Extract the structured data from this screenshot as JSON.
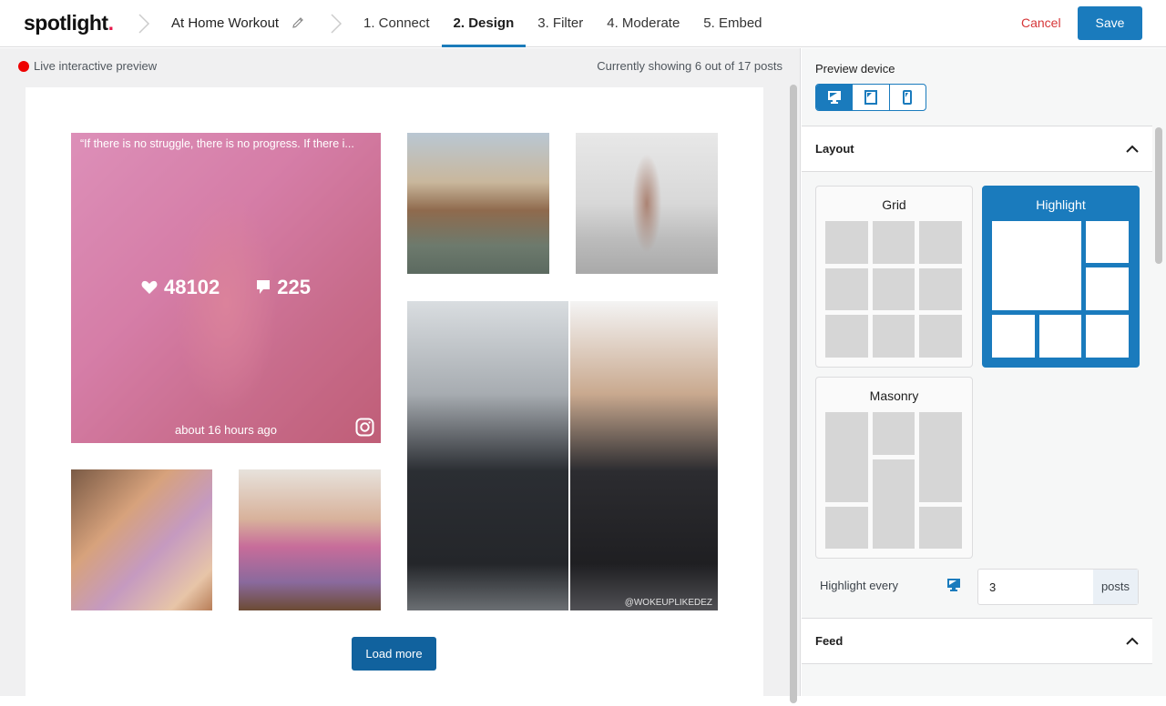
{
  "header": {
    "logo": "spotlight",
    "logo_dot": ".",
    "feed_name": "At Home Workout",
    "steps": [
      {
        "label": "1. Connect",
        "active": false
      },
      {
        "label": "2. Design",
        "active": true
      },
      {
        "label": "3. Filter",
        "active": false
      },
      {
        "label": "4. Moderate",
        "active": false
      },
      {
        "label": "5. Embed",
        "active": false
      }
    ],
    "cancel_label": "Cancel",
    "save_label": "Save"
  },
  "preview": {
    "live_label": "Live interactive preview",
    "showing_text": "Currently showing 6 out of 17 posts",
    "highlighted_post": {
      "caption": "“If there is no struggle, there is no progress. If there i...",
      "likes": "48102",
      "comments": "225",
      "time": "about 16 hours ago"
    },
    "watermark": "@WOKEUPLIKEDEZ",
    "load_more_label": "Load more"
  },
  "sidebar": {
    "preview_device_label": "Preview device",
    "devices": [
      "desktop",
      "tablet",
      "phone"
    ],
    "active_device": "desktop",
    "layout_section": {
      "title": "Layout",
      "options": [
        "Grid",
        "Highlight",
        "Masonry"
      ],
      "selected": "Highlight"
    },
    "highlight_every": {
      "label": "Highlight every",
      "value": "3",
      "suffix": "posts"
    },
    "feed_section": {
      "title": "Feed"
    }
  },
  "colors": {
    "accent": "#1a7bbd",
    "cancel": "#d63638",
    "live_dot": "#ee0000",
    "overlay": "#d04a94"
  }
}
